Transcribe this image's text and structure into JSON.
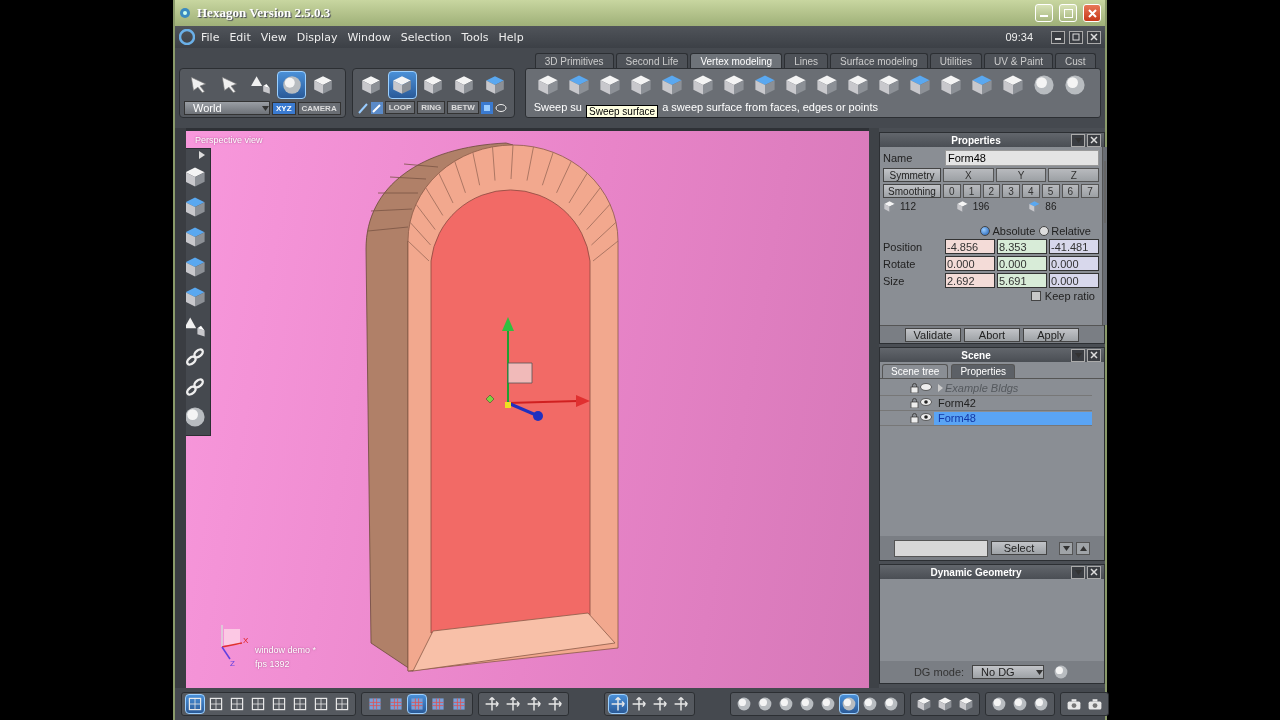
{
  "window": {
    "title": "Hexagon Version 2.5.0.3"
  },
  "menu": [
    "File",
    "Edit",
    "View",
    "Display",
    "Window",
    "Selection",
    "Tools",
    "Help"
  ],
  "clock": "09:34",
  "select_tools": [
    {
      "selected": false
    },
    {
      "selected": false
    },
    {
      "selected": false
    },
    {
      "selected": true
    },
    {
      "selected": false
    }
  ],
  "space_dropdown": {
    "value": "World"
  },
  "space_modes": [
    {
      "label": "XYZ",
      "selected": true
    },
    {
      "label": "CAMERA",
      "selected": false
    }
  ],
  "selection_modes": [
    {
      "selected": false
    },
    {
      "selected": true
    },
    {
      "selected": false
    },
    {
      "selected": false
    },
    {
      "selected": false
    }
  ],
  "selection_options": [
    "LOOP",
    "RING",
    "BETW"
  ],
  "tabs": [
    {
      "label": "3D Primitives",
      "selected": false
    },
    {
      "label": "Second Life",
      "selected": false
    },
    {
      "label": "Vertex modeling",
      "selected": true
    },
    {
      "label": "Lines",
      "selected": false
    },
    {
      "label": "Surface modeling",
      "selected": false
    },
    {
      "label": "Utilities",
      "selected": false
    },
    {
      "label": "UV & Paint",
      "selected": false
    },
    {
      "label": "Cust",
      "selected": false
    }
  ],
  "status": {
    "before": "Sweep su",
    "tooltip": "Sweep surface",
    "after": "a sweep surface from faces, edges or points"
  },
  "viewport": {
    "label": "Perspective view",
    "object": "window demo *",
    "fps": "fps 1392",
    "axes": [
      "X",
      "Z"
    ]
  },
  "properties": {
    "title": "Properties",
    "name_label": "Name",
    "name_value": "Form48",
    "symmetry": {
      "label": "Symmetry",
      "axes": [
        {
          "label": "X",
          "selected": false
        },
        {
          "label": "Y",
          "selected": false
        },
        {
          "label": "Z",
          "selected": false
        }
      ]
    },
    "smoothing": {
      "label": "Smoothing",
      "levels": [
        {
          "label": "0",
          "selected": false
        },
        {
          "label": "1",
          "selected": false
        },
        {
          "label": "2",
          "selected": false
        },
        {
          "label": "3",
          "selected": false
        },
        {
          "label": "4",
          "selected": false
        },
        {
          "label": "5",
          "selected": false
        },
        {
          "label": "6",
          "selected": false
        },
        {
          "label": "7",
          "selected": false
        }
      ]
    },
    "counts": [
      "112",
      "196",
      "86"
    ],
    "coord_modes": [
      {
        "label": "Absolute",
        "selected": true
      },
      {
        "label": "Relative",
        "selected": false
      }
    ],
    "transforms": [
      {
        "label": "Position",
        "values": [
          "-4.856",
          "8.353",
          "-41.481"
        ]
      },
      {
        "label": "Rotate",
        "values": [
          "0.000",
          "0.000",
          "0.000"
        ]
      },
      {
        "label": "Size",
        "values": [
          "2.692",
          "5.691",
          "0.000"
        ]
      }
    ],
    "keep_ratio": {
      "label": "Keep ratio",
      "checked": false
    },
    "buttons": [
      "Validate",
      "Abort",
      "Apply"
    ]
  },
  "scene": {
    "title": "Scene",
    "tabs": [
      {
        "label": "Scene tree",
        "selected": true
      },
      {
        "label": "Properties",
        "selected": false
      }
    ],
    "items": [
      {
        "name": "Example Bldgs",
        "disabled": true,
        "selected": false
      },
      {
        "name": "Form42",
        "disabled": false,
        "selected": false
      },
      {
        "name": "Form48",
        "disabled": false,
        "selected": true
      }
    ],
    "select_button": "Select"
  },
  "dynamic_geometry": {
    "title": "Dynamic Geometry",
    "mode_label": "DG mode:",
    "mode_value": "No DG"
  },
  "bottom_toolbar": [
    [
      {
        "selected": true
      },
      {
        "selected": false
      },
      {
        "selected": false
      },
      {
        "selected": false
      },
      {
        "selected": false
      },
      {
        "selected": false
      },
      {
        "selected": false
      },
      {
        "selected": false
      }
    ],
    [
      {
        "selected": false
      },
      {
        "selected": false
      },
      {
        "selected": true
      },
      {
        "selected": false
      },
      {
        "selected": false
      }
    ],
    [
      {
        "selected": false
      },
      {
        "selected": false
      },
      {
        "selected": false
      },
      {
        "selected": false
      }
    ],
    [
      {
        "selected": true
      },
      {
        "selected": false
      },
      {
        "selected": false
      },
      {
        "selected": false
      }
    ],
    [
      {
        "selected": false
      },
      {
        "selected": false
      },
      {
        "selected": false
      },
      {
        "selected": false
      },
      {
        "selected": false
      },
      {
        "selected": true
      },
      {
        "selected": false
      },
      {
        "selected": false
      }
    ],
    [
      {
        "selected": false
      },
      {
        "selected": false
      },
      {
        "selected": false
      }
    ],
    [
      {
        "selected": false
      },
      {
        "selected": false
      },
      {
        "selected": false
      }
    ],
    [
      {
        "selected": false
      },
      {
        "selected": false
      }
    ]
  ]
}
